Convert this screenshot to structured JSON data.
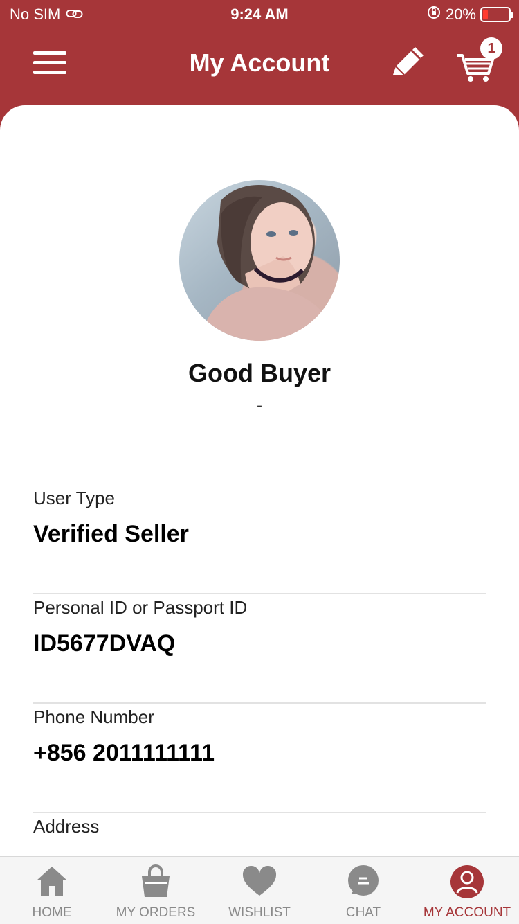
{
  "status_bar": {
    "carrier": "No SIM",
    "time": "9:24 AM",
    "battery_percent": "20%",
    "battery_level": 0.2,
    "icons": [
      "link-icon",
      "orientation-lock-icon",
      "battery-icon"
    ]
  },
  "header": {
    "title": "My Account",
    "cart_count": "1"
  },
  "profile": {
    "name": "Good Buyer",
    "subtitle": "-"
  },
  "fields": [
    {
      "label": "User Type",
      "value": "Verified Seller"
    },
    {
      "label": "Personal ID or Passport ID",
      "value": "ID5677DVAQ"
    },
    {
      "label": "Phone Number",
      "value": "+856 2011111111"
    },
    {
      "label": "Address",
      "value": ""
    }
  ],
  "tabbar": {
    "items": [
      {
        "label": "HOME",
        "icon": "home-icon"
      },
      {
        "label": "MY ORDERS",
        "icon": "shopping-bag-icon"
      },
      {
        "label": "WISHLIST",
        "icon": "heart-icon"
      },
      {
        "label": "CHAT",
        "icon": "chat-bubble-icon"
      },
      {
        "label": "MY ACCOUNT",
        "icon": "user-icon",
        "active": true
      }
    ]
  },
  "colors": {
    "brand": "#a63639",
    "inactive": "#8a8a8a",
    "card_bg": "#ffffff"
  }
}
